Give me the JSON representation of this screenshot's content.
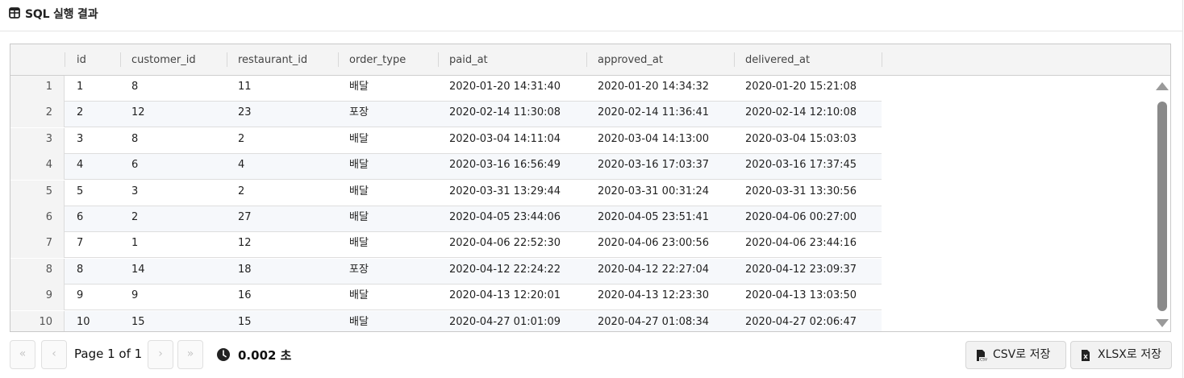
{
  "header": {
    "title": "SQL 실행 결과",
    "icon": "table-icon"
  },
  "table": {
    "columns": [
      "id",
      "customer_id",
      "restaurant_id",
      "order_type",
      "paid_at",
      "approved_at",
      "delivered_at"
    ],
    "rows": [
      {
        "num": "1",
        "cells": [
          "1",
          "8",
          "11",
          "배달",
          "2020-01-20 14:31:40",
          "2020-01-20 14:34:32",
          "2020-01-20 15:21:08"
        ]
      },
      {
        "num": "2",
        "cells": [
          "2",
          "12",
          "23",
          "포장",
          "2020-02-14 11:30:08",
          "2020-02-14 11:36:41",
          "2020-02-14 12:10:08"
        ]
      },
      {
        "num": "3",
        "cells": [
          "3",
          "8",
          "2",
          "배달",
          "2020-03-04 14:11:04",
          "2020-03-04 14:13:00",
          "2020-03-04 15:03:03"
        ]
      },
      {
        "num": "4",
        "cells": [
          "4",
          "6",
          "4",
          "배달",
          "2020-03-16 16:56:49",
          "2020-03-16 17:03:37",
          "2020-03-16 17:37:45"
        ]
      },
      {
        "num": "5",
        "cells": [
          "5",
          "3",
          "2",
          "배달",
          "2020-03-31 13:29:44",
          "2020-03-31 00:31:24",
          "2020-03-31 13:30:56"
        ]
      },
      {
        "num": "6",
        "cells": [
          "6",
          "2",
          "27",
          "배달",
          "2020-04-05 23:44:06",
          "2020-04-05 23:51:41",
          "2020-04-06 00:27:00"
        ]
      },
      {
        "num": "7",
        "cells": [
          "7",
          "1",
          "12",
          "배달",
          "2020-04-06 22:52:30",
          "2020-04-06 23:00:56",
          "2020-04-06 23:44:16"
        ]
      },
      {
        "num": "8",
        "cells": [
          "8",
          "14",
          "18",
          "포장",
          "2020-04-12 22:24:22",
          "2020-04-12 22:27:04",
          "2020-04-12 23:09:37"
        ]
      },
      {
        "num": "9",
        "cells": [
          "9",
          "9",
          "16",
          "배달",
          "2020-04-13 12:20:01",
          "2020-04-13 12:23:30",
          "2020-04-13 13:03:50"
        ]
      },
      {
        "num": "10",
        "cells": [
          "10",
          "15",
          "15",
          "배달",
          "2020-04-27 01:01:09",
          "2020-04-27 01:08:34",
          "2020-04-27 02:06:47"
        ]
      }
    ]
  },
  "pager": {
    "first": "«",
    "prev": "‹",
    "next": "›",
    "last": "»",
    "page_text": "Page 1 of 1",
    "elapsed": "0.002 초"
  },
  "actions": {
    "csv_label": "CSV로 저장",
    "xlsx_label": "XLSX로 저장"
  },
  "colors": {
    "header_bg": "#f4f4f4",
    "alt_row": "#f6f8fb",
    "scroll_thumb": "#8a8a8a"
  }
}
